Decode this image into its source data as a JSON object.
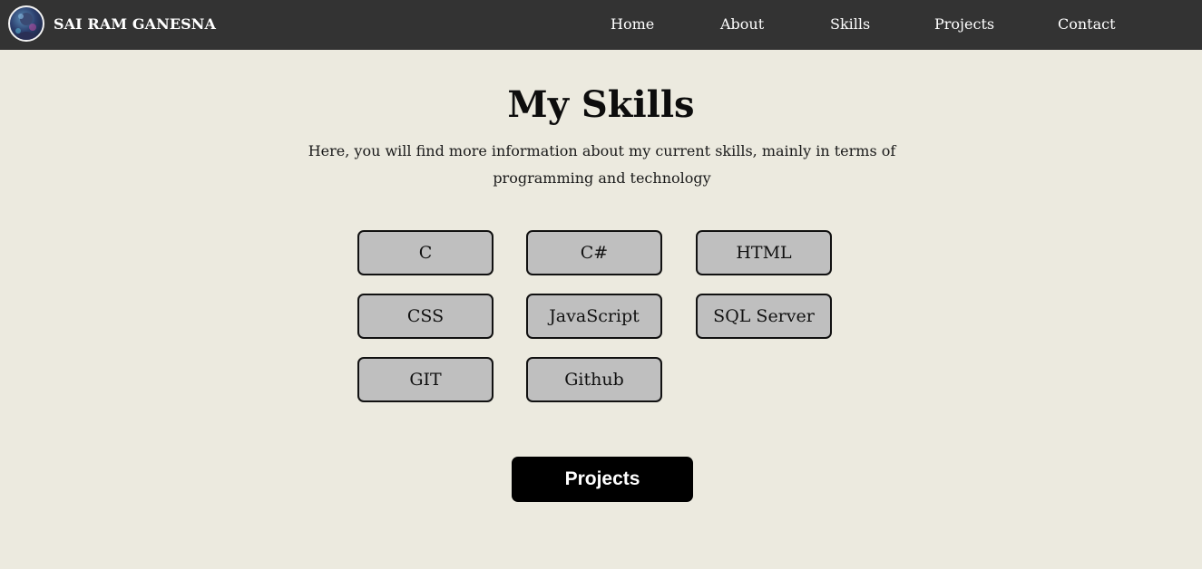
{
  "brand": {
    "name": "SAI RAM GANESNA",
    "avatar_icon": "profile-avatar"
  },
  "nav": {
    "items": [
      {
        "label": "Home"
      },
      {
        "label": "About"
      },
      {
        "label": "Skills"
      },
      {
        "label": "Projects"
      },
      {
        "label": "Contact"
      }
    ]
  },
  "main": {
    "title": "My Skills",
    "intro": "Here, you will find more information about my current skills, mainly in terms of programming and technology",
    "skills": [
      {
        "label": "C"
      },
      {
        "label": "C#"
      },
      {
        "label": "HTML"
      },
      {
        "label": "CSS"
      },
      {
        "label": "JavaScript"
      },
      {
        "label": "SQL Server"
      },
      {
        "label": "GIT"
      },
      {
        "label": "Github"
      }
    ],
    "cta_label": "Projects"
  },
  "colors": {
    "background": "#ECEADF",
    "navbar": "#333333",
    "skill_fill": "#BFBFBF",
    "button": "#000000"
  }
}
